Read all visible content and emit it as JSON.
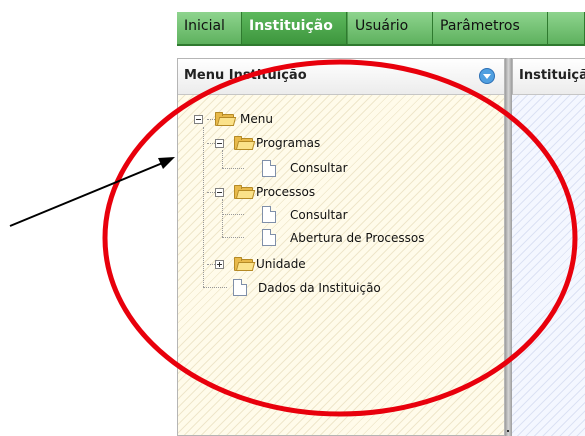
{
  "tabs": [
    {
      "label": "Inicial",
      "active": false
    },
    {
      "label": "Instituição",
      "active": true
    },
    {
      "label": "Usuário",
      "active": false
    },
    {
      "label": "Parâmetros",
      "active": false
    },
    {
      "label": "",
      "active": false
    }
  ],
  "left_panel": {
    "title": "Menu Instituição",
    "collapse_icon": "chevron-down-circle-icon"
  },
  "right_panel": {
    "title": "Instituiçã"
  },
  "tree": {
    "root": "Menu",
    "programas": {
      "label": "Programas",
      "children": [
        "Consultar"
      ]
    },
    "processos": {
      "label": "Processos",
      "children": [
        "Consultar",
        "Abertura de Processos"
      ]
    },
    "unidade": {
      "label": "Unidade",
      "collapsed": true
    },
    "dados": "Dados da Instituição"
  },
  "annotation": {
    "ellipse_color": "#e8000c",
    "arrow_color": "#000000"
  }
}
